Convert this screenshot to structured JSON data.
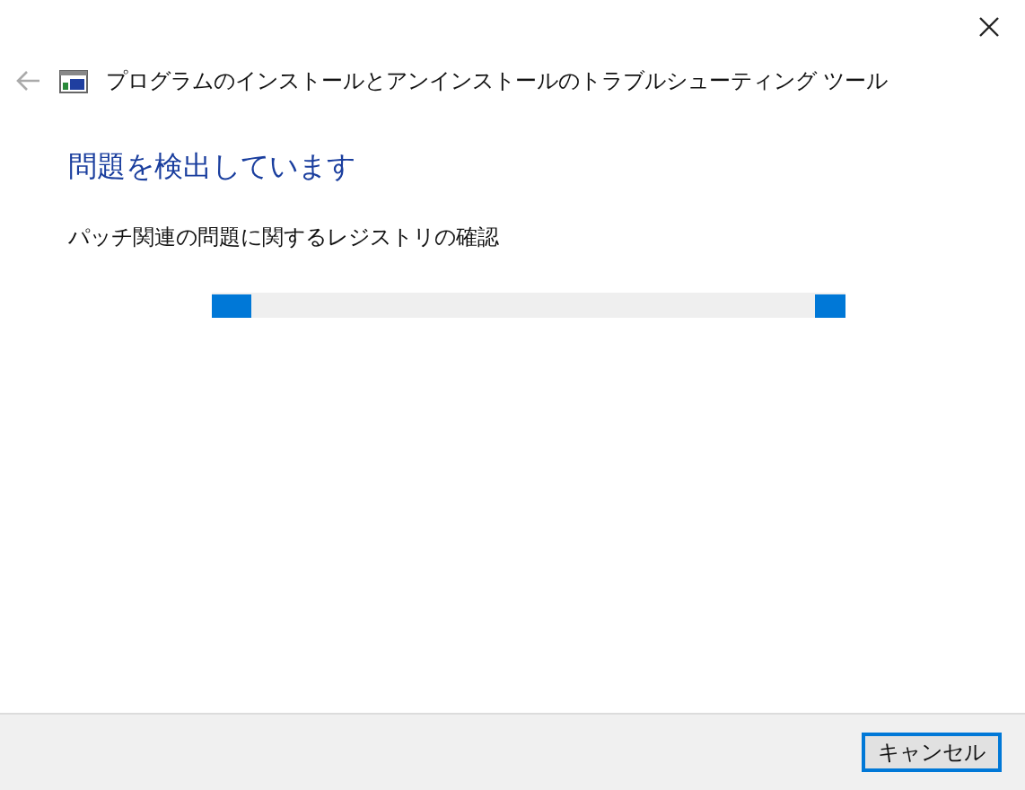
{
  "window": {
    "title": "プログラムのインストールとアンインストールのトラブルシューティング ツール"
  },
  "heading": "問題を検出しています",
  "status": "パッチ関連の問題に関するレジストリの確認",
  "progress": {
    "kind": "marquee"
  },
  "buttons": [
    {
      "label": "キャンセル",
      "focused": true
    }
  ]
}
